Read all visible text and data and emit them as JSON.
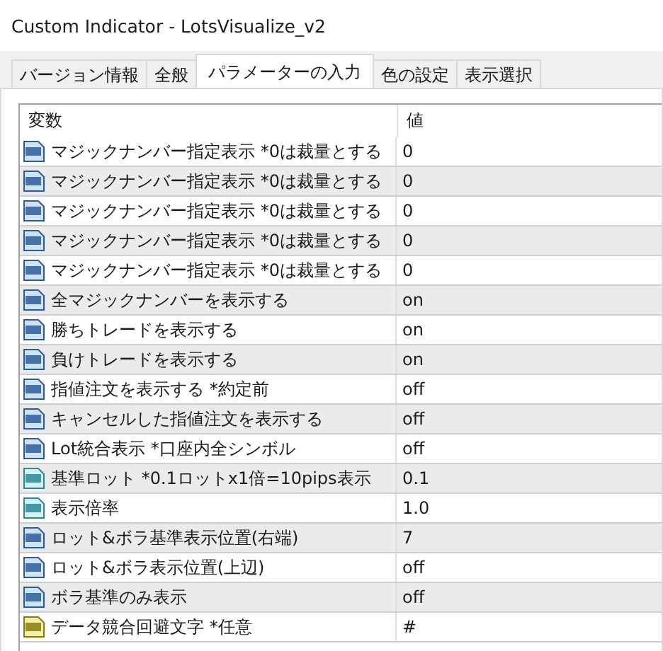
{
  "window": {
    "title": "Custom Indicator - LotsVisualize_v2"
  },
  "tabs": [
    {
      "label": "バージョン情報",
      "selected": false
    },
    {
      "label": "全般",
      "selected": false
    },
    {
      "label": "パラメーターの入力",
      "selected": true
    },
    {
      "label": "色の設定",
      "selected": false
    },
    {
      "label": "表示選択",
      "selected": false
    }
  ],
  "table": {
    "columns": [
      "変数",
      "値"
    ],
    "rows": [
      {
        "kind": "int",
        "name": "マジックナンバー指定表示 *0は裁量とする",
        "value": "0"
      },
      {
        "kind": "int",
        "name": "マジックナンバー指定表示 *0は裁量とする",
        "value": "0"
      },
      {
        "kind": "int",
        "name": "マジックナンバー指定表示 *0は裁量とする",
        "value": "0"
      },
      {
        "kind": "int",
        "name": "マジックナンバー指定表示 *0は裁量とする",
        "value": "0"
      },
      {
        "kind": "int",
        "name": "マジックナンバー指定表示 *0は裁量とする",
        "value": "0"
      },
      {
        "kind": "int",
        "name": "全マジックナンバーを表示する",
        "value": "on"
      },
      {
        "kind": "int",
        "name": "勝ちトレードを表示する",
        "value": "on"
      },
      {
        "kind": "int",
        "name": "負けトレードを表示する",
        "value": "on"
      },
      {
        "kind": "int",
        "name": "指値注文を表示する *約定前",
        "value": "off"
      },
      {
        "kind": "int",
        "name": "キャンセルした指値注文を表示する",
        "value": "off"
      },
      {
        "kind": "int",
        "name": "Lot統合表示 *口座内全シンボル",
        "value": "off"
      },
      {
        "kind": "double",
        "name": "基準ロット *0.1ロットx1倍=10pips表示",
        "value": "0.1"
      },
      {
        "kind": "double",
        "name": "表示倍率",
        "value": "1.0"
      },
      {
        "kind": "int",
        "name": "ロット&ボラ基準表示位置(右端)",
        "value": "7"
      },
      {
        "kind": "int",
        "name": "ロット&ボラ表示位置(上辺)",
        "value": "off"
      },
      {
        "kind": "int",
        "name": "ボラ基準のみ表示",
        "value": "off"
      },
      {
        "kind": "string",
        "name": "データ競合回避文字 *任意",
        "value": "#"
      }
    ]
  }
}
